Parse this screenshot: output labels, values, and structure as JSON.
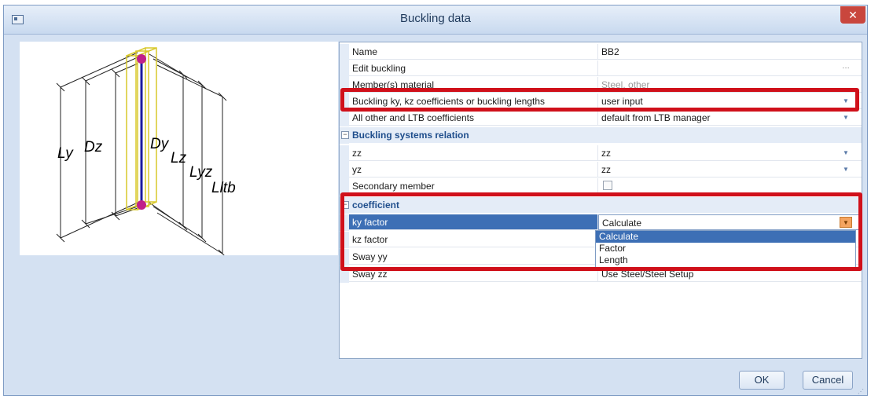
{
  "window": {
    "title": "Buckling data",
    "close_glyph": "✕"
  },
  "preview": {
    "labels": {
      "ly": "Ly",
      "dz": "Dz",
      "dy": "Dy",
      "lz": "Lz",
      "lyz": "Lyz",
      "lltb": "Lltb"
    }
  },
  "properties": {
    "rows": [
      {
        "name": "Name",
        "value": "BB2"
      },
      {
        "name": "Edit buckling",
        "value": ""
      },
      {
        "name": "Member(s) material",
        "value": "Steel, other"
      },
      {
        "name": "Buckling ky, kz coefficients or buckling lengths",
        "value": "user input"
      },
      {
        "name": "All other and LTB coefficients",
        "value": "default from LTB manager"
      }
    ],
    "sections": {
      "buckling_systems_relation": {
        "title": "Buckling systems relation",
        "rows": [
          {
            "name": "zz",
            "value": "zz"
          },
          {
            "name": "yz",
            "value": "zz"
          },
          {
            "name": "Secondary member",
            "value": ""
          }
        ]
      },
      "coefficient": {
        "title": "coefficient",
        "rows": [
          {
            "name": "ky factor",
            "value": "Calculate"
          },
          {
            "name": "kz factor",
            "value": ""
          },
          {
            "name": "Sway yy",
            "value": ""
          },
          {
            "name": "Sway zz",
            "value": "Use Steel/Steel Setup"
          }
        ]
      }
    }
  },
  "dropdown": {
    "options": [
      "Calculate",
      "Factor",
      "Length"
    ],
    "selected": "Calculate"
  },
  "buttons": {
    "ok": "OK",
    "cancel": "Cancel"
  },
  "colors": {
    "highlight_box": "#d0101a",
    "selection": "#3d6fb5",
    "active_dropdown": "#f4a460"
  }
}
